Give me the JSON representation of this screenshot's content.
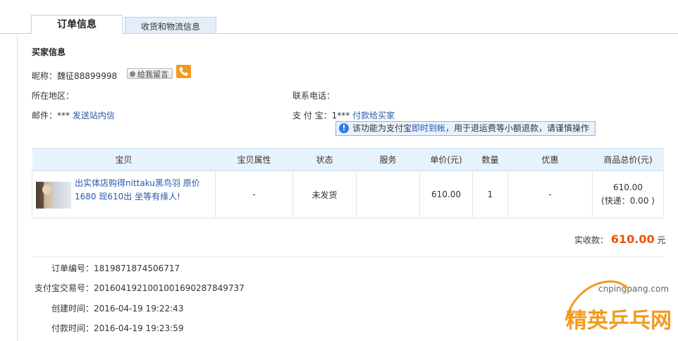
{
  "tabs": [
    {
      "label": "订单信息",
      "active": true
    },
    {
      "label": "收货和物流信息",
      "active": false
    }
  ],
  "buyer": {
    "section_title": "买家信息",
    "nickname_label": "昵称：",
    "nickname": "魏征88899998",
    "message_button": "给我留言",
    "region_label": "所在地区：",
    "region": "",
    "phone_label": "联系电话：",
    "phone": "",
    "email_label": "邮件：",
    "email": "***",
    "email_link": "发送站内信",
    "alipay_label": "支 付 宝：",
    "alipay": "1***",
    "alipay_link": "付款给买家",
    "tip_prefix": "该功能为支付宝",
    "tip_highlight": "即时到帐",
    "tip_suffix": "，用于退运费等小额退款，请谨慎操作"
  },
  "table": {
    "headers": [
      "宝贝",
      "宝贝属性",
      "状态",
      "服务",
      "单价(元)",
      "数量",
      "优惠",
      "商品总价(元)"
    ],
    "rows": [
      {
        "title": "出实体店购得nittaku黑鸟羽 原价1680 现610出 坐等有缘人!",
        "attributes": "-",
        "status": "未发货",
        "service": "",
        "unit_price": "610.00",
        "quantity": "1",
        "discount": "-",
        "total": "610.00",
        "shipping": "(快递：0.00 )"
      }
    ]
  },
  "summary": {
    "label": "实收款：",
    "amount": "610.00",
    "unit": "元"
  },
  "order_meta": [
    {
      "label": "订单编号：",
      "value": "1819871874506717"
    },
    {
      "label": "支付宝交易号：",
      "value": "2016041921001001690287849737"
    },
    {
      "label": "创建时间：",
      "value": "2016-04-19 19:22:43"
    },
    {
      "label": "付款时间：",
      "value": "2016-04-19 19:23:59"
    }
  ],
  "watermark": {
    "url": "cnpingpang.com",
    "text": "精英乒乓网"
  },
  "colors": {
    "accent_link": "#2857a7",
    "price": "#e8540a",
    "header_bg": "#e8f2fd",
    "phone_button": "#f29a1e"
  }
}
